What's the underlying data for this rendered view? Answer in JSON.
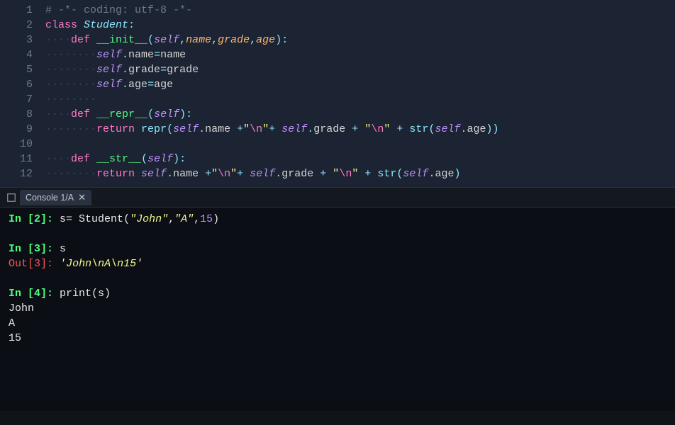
{
  "editor": {
    "lines": [
      {
        "num": "1",
        "tokens": [
          [
            "comment",
            "# -*- coding: utf-8 -*-"
          ]
        ]
      },
      {
        "num": "2",
        "tokens": [
          [
            "kw",
            "class"
          ],
          [
            "",
            ""
          ],
          [
            "cls",
            "Student"
          ],
          [
            "op",
            ":"
          ]
        ]
      },
      {
        "num": "3",
        "tokens": [
          [
            "ws",
            "····"
          ],
          [
            "kw",
            "def"
          ],
          [
            "",
            ""
          ],
          [
            "fn",
            "__init__"
          ],
          [
            "op",
            "("
          ],
          [
            "self",
            "self"
          ],
          [
            "op",
            ","
          ],
          [
            "param",
            "name"
          ],
          [
            "op",
            ","
          ],
          [
            "param",
            "grade"
          ],
          [
            "op",
            ","
          ],
          [
            "param",
            "age"
          ],
          [
            "op",
            ")"
          ],
          [
            "op",
            ":"
          ]
        ]
      },
      {
        "num": "4",
        "tokens": [
          [
            "ws",
            "········"
          ],
          [
            "self",
            "self"
          ],
          [
            "op",
            "."
          ],
          [
            "prop",
            "name"
          ],
          [
            "op",
            "="
          ],
          [
            "prop",
            "name"
          ]
        ]
      },
      {
        "num": "5",
        "tokens": [
          [
            "ws",
            "········"
          ],
          [
            "self",
            "self"
          ],
          [
            "op",
            "."
          ],
          [
            "prop",
            "grade"
          ],
          [
            "op",
            "="
          ],
          [
            "prop",
            "grade"
          ]
        ]
      },
      {
        "num": "6",
        "tokens": [
          [
            "ws",
            "········"
          ],
          [
            "self",
            "self"
          ],
          [
            "op",
            "."
          ],
          [
            "prop",
            "age"
          ],
          [
            "op",
            "="
          ],
          [
            "prop",
            "age"
          ]
        ]
      },
      {
        "num": "7",
        "tokens": [
          [
            "ws",
            "········"
          ]
        ]
      },
      {
        "num": "8",
        "tokens": [
          [
            "ws",
            "····"
          ],
          [
            "kw",
            "def"
          ],
          [
            "",
            ""
          ],
          [
            "fn",
            "__repr__"
          ],
          [
            "op",
            "("
          ],
          [
            "self",
            "self"
          ],
          [
            "op",
            ")"
          ],
          [
            "op",
            ":"
          ]
        ]
      },
      {
        "num": "9",
        "tokens": [
          [
            "ws",
            "········"
          ],
          [
            "kw",
            "return"
          ],
          [
            "",
            ""
          ],
          [
            "builtin",
            "repr"
          ],
          [
            "op",
            "("
          ],
          [
            "self",
            "self"
          ],
          [
            "op",
            "."
          ],
          [
            "prop",
            "name"
          ],
          [
            "",
            ""
          ],
          [
            "op",
            "+"
          ],
          [
            "str",
            "\""
          ],
          [
            "esc",
            "\\n"
          ],
          [
            "str",
            "\""
          ],
          [
            "op",
            "+"
          ],
          [
            "",
            ""
          ],
          [
            "self",
            "self"
          ],
          [
            "op",
            "."
          ],
          [
            "prop",
            "grade"
          ],
          [
            "",
            ""
          ],
          [
            "op",
            "+"
          ],
          [
            "",
            ""
          ],
          [
            "str",
            "\""
          ],
          [
            "esc",
            "\\n"
          ],
          [
            "str",
            "\""
          ],
          [
            "",
            ""
          ],
          [
            "op",
            "+"
          ],
          [
            "",
            ""
          ],
          [
            "builtin",
            "str"
          ],
          [
            "op",
            "("
          ],
          [
            "self",
            "self"
          ],
          [
            "op",
            "."
          ],
          [
            "prop",
            "age"
          ],
          [
            "op",
            ")"
          ],
          [
            "op",
            ")"
          ]
        ]
      },
      {
        "num": "10",
        "tokens": []
      },
      {
        "num": "11",
        "tokens": [
          [
            "ws",
            "····"
          ],
          [
            "kw",
            "def"
          ],
          [
            "",
            ""
          ],
          [
            "fn",
            "__str__"
          ],
          [
            "op",
            "("
          ],
          [
            "self",
            "self"
          ],
          [
            "op",
            ")"
          ],
          [
            "op",
            ":"
          ]
        ]
      },
      {
        "num": "12",
        "tokens": [
          [
            "ws",
            "········"
          ],
          [
            "kw",
            "return"
          ],
          [
            "",
            ""
          ],
          [
            "self",
            "self"
          ],
          [
            "op",
            "."
          ],
          [
            "prop",
            "name"
          ],
          [
            "",
            ""
          ],
          [
            "op",
            "+"
          ],
          [
            "str",
            "\""
          ],
          [
            "esc",
            "\\n"
          ],
          [
            "str",
            "\""
          ],
          [
            "op",
            "+"
          ],
          [
            "",
            ""
          ],
          [
            "self",
            "self"
          ],
          [
            "op",
            "."
          ],
          [
            "prop",
            "grade"
          ],
          [
            "",
            ""
          ],
          [
            "op",
            "+"
          ],
          [
            "",
            ""
          ],
          [
            "str",
            "\""
          ],
          [
            "esc",
            "\\n"
          ],
          [
            "str",
            "\""
          ],
          [
            "",
            ""
          ],
          [
            "op",
            "+"
          ],
          [
            "",
            ""
          ],
          [
            "builtin",
            "str"
          ],
          [
            "op",
            "("
          ],
          [
            "self",
            "self"
          ],
          [
            "op",
            "."
          ],
          [
            "prop",
            "age"
          ],
          [
            "op",
            ")"
          ]
        ]
      }
    ]
  },
  "console": {
    "tab_label": "Console 1/A",
    "close_glyph": "✕",
    "cells": [
      {
        "in_prompt": "In [",
        "in_num": "2",
        "in_close": "]:",
        "code_tokens": [
          [
            "con-text",
            " s= Student("
          ],
          [
            "con-str",
            "\"John\""
          ],
          [
            "con-text",
            ","
          ],
          [
            "con-str",
            "\"A\""
          ],
          [
            "con-text",
            ","
          ],
          [
            "con-num",
            "15"
          ],
          [
            "con-text",
            ")"
          ]
        ],
        "out": null,
        "stdout": []
      },
      {
        "in_prompt": "In [",
        "in_num": "3",
        "in_close": "]:",
        "code_tokens": [
          [
            "con-text",
            " s"
          ]
        ],
        "out": {
          "prompt": "Out[",
          "num": "3",
          "close": "]:",
          "tokens": [
            [
              "con-text",
              " "
            ],
            [
              "con-str",
              "'John\\nA\\n15'"
            ]
          ]
        },
        "stdout": []
      },
      {
        "in_prompt": "In [",
        "in_num": "4",
        "in_close": "]:",
        "code_tokens": [
          [
            "con-text",
            " print(s)"
          ]
        ],
        "out": null,
        "stdout": [
          "John",
          "A",
          "15"
        ]
      }
    ]
  }
}
